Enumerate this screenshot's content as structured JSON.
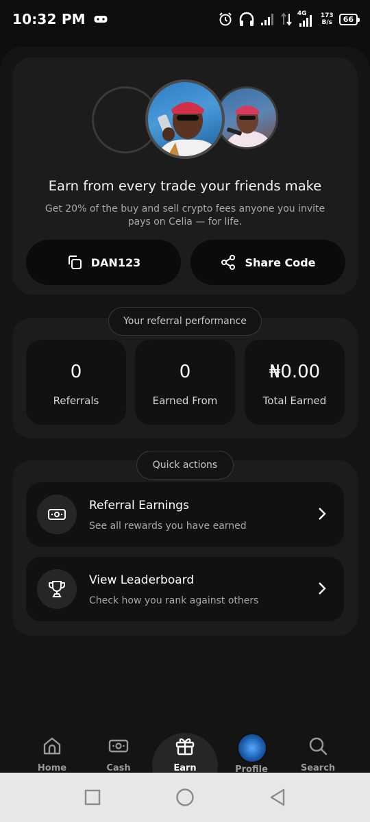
{
  "status_bar": {
    "time": "10:32 PM",
    "network_type": "4G",
    "net_speed_value": "173",
    "net_speed_unit": "B/s",
    "battery": "66"
  },
  "hero": {
    "title": "Earn from every trade your friends make",
    "subtitle": "Get 20% of the buy and sell crypto fees anyone you invite pays on Celia — for life.",
    "referral_code": "DAN123",
    "share_label": "Share Code"
  },
  "performance": {
    "chip_label": "Your referral performance",
    "stats": [
      {
        "value": "0",
        "label": "Referrals"
      },
      {
        "value": "0",
        "label": "Earned From"
      },
      {
        "value": "₦0.00",
        "label": "Total Earned"
      }
    ]
  },
  "quick_actions": {
    "chip_label": "Quick actions",
    "items": [
      {
        "title": "Referral Earnings",
        "subtitle": "See all rewards you have earned",
        "icon": "cash-icon"
      },
      {
        "title": "View Leaderboard",
        "subtitle": "Check how you rank against others",
        "icon": "trophy-icon"
      }
    ]
  },
  "bottom_nav": {
    "items": [
      {
        "label": "Home",
        "icon": "home-icon"
      },
      {
        "label": "Cash",
        "icon": "cash-icon"
      },
      {
        "label": "Earn",
        "icon": "gift-icon",
        "active": true
      },
      {
        "label": "Profile",
        "icon": "avatar"
      },
      {
        "label": "Search",
        "icon": "search-icon"
      }
    ]
  },
  "colors": {
    "background": "#0e0e0e",
    "card": "#1c1c1c",
    "button": "#0b0b0b",
    "muted_text": "#a8a8a8"
  }
}
